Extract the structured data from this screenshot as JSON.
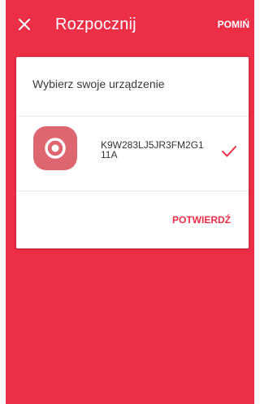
{
  "app_bar": {
    "title": "Rozpocznij",
    "skip_label": "POMIŃ",
    "close_icon": "close-icon"
  },
  "card": {
    "heading": "Wybierz swoje urządzenie",
    "device": {
      "name": "K9W283LJ5JR3FM2G111A",
      "icon": "target-icon",
      "selected": true
    },
    "confirm_label": "POTWIERDŹ"
  },
  "colors": {
    "primary": "#ec2e47",
    "device_icon_bg": "#dd6670",
    "card": "#ffffff",
    "check": "#ec2e47"
  }
}
